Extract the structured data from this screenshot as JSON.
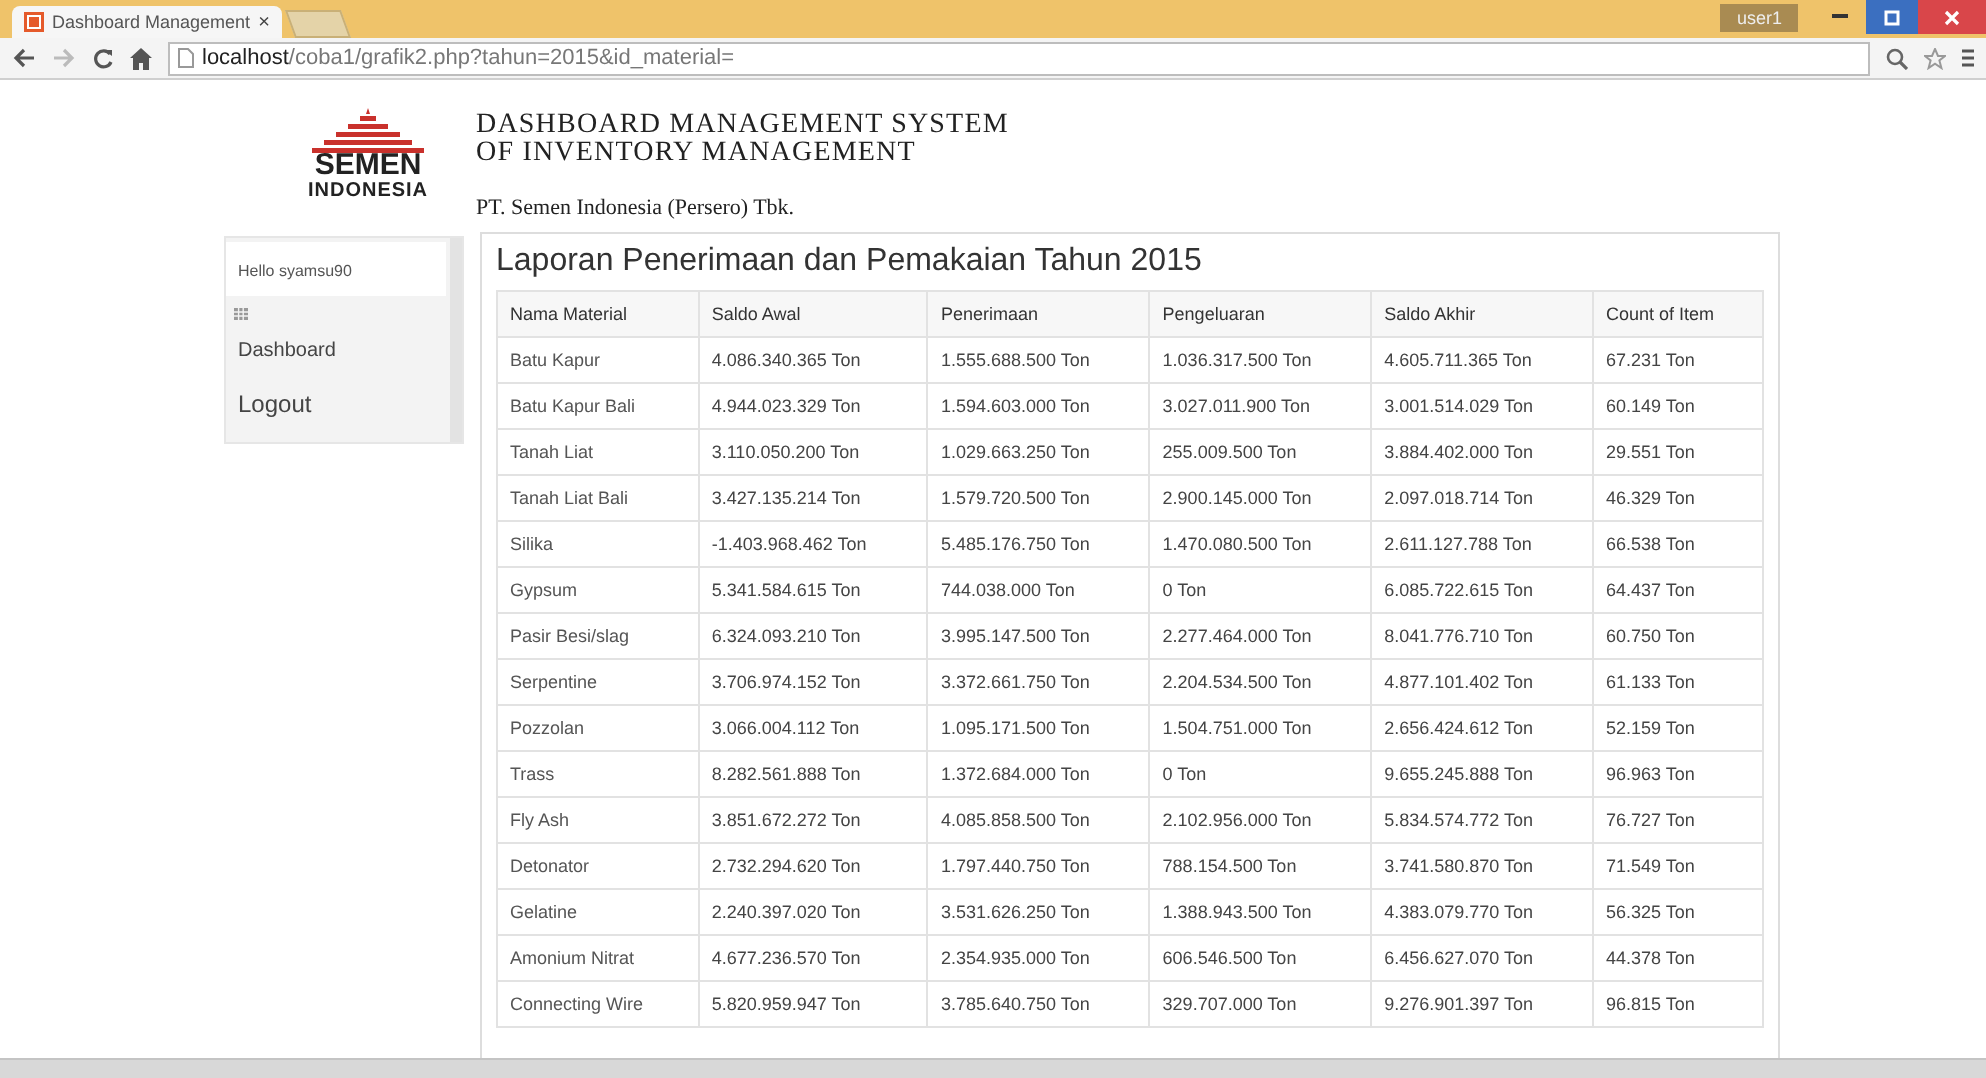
{
  "browser": {
    "tab_title": "Dashboard Management",
    "tab_close": "×",
    "address": "localhost/coba1/grafik2.php?tahun=2015&id_material=",
    "user_badge": "user1"
  },
  "header": {
    "logo_word": "SEMEN",
    "logo_subword": "INDONESIA",
    "title_line_1": "DASHBOARD MANAGEMENT SYSTEM",
    "title_line_2": "OF INVENTORY MANAGEMENT",
    "company": "PT. Semen Indonesia (Persero) Tbk."
  },
  "sidebar": {
    "greeting": "Hello syamsu90",
    "items": [
      {
        "label": "Dashboard"
      },
      {
        "label": "Logout"
      }
    ]
  },
  "report": {
    "title": "Laporan Penerimaan dan Pemakaian Tahun 2015",
    "columns": [
      "Nama Material",
      "Saldo Awal",
      "Penerimaan",
      "Pengeluaran",
      "Saldo Akhir",
      "Count of Item"
    ],
    "rows": [
      [
        "Batu Kapur",
        "4.086.340.365 Ton",
        "1.555.688.500 Ton",
        "1.036.317.500 Ton",
        "4.605.711.365 Ton",
        "67.231 Ton"
      ],
      [
        "Batu Kapur Bali",
        "4.944.023.329 Ton",
        "1.594.603.000 Ton",
        "3.027.011.900 Ton",
        "3.001.514.029 Ton",
        "60.149 Ton"
      ],
      [
        "Tanah Liat",
        "3.110.050.200 Ton",
        "1.029.663.250 Ton",
        "255.009.500 Ton",
        "3.884.402.000 Ton",
        "29.551 Ton"
      ],
      [
        "Tanah Liat Bali",
        "3.427.135.214 Ton",
        "1.579.720.500 Ton",
        "2.900.145.000 Ton",
        "2.097.018.714 Ton",
        "46.329 Ton"
      ],
      [
        "Silika",
        "-1.403.968.462 Ton",
        "5.485.176.750 Ton",
        "1.470.080.500 Ton",
        "2.611.127.788 Ton",
        "66.538 Ton"
      ],
      [
        "Gypsum",
        "5.341.584.615 Ton",
        "744.038.000 Ton",
        "0 Ton",
        "6.085.722.615 Ton",
        "64.437 Ton"
      ],
      [
        "Pasir Besi/slag",
        "6.324.093.210 Ton",
        "3.995.147.500 Ton",
        "2.277.464.000 Ton",
        "8.041.776.710 Ton",
        "60.750 Ton"
      ],
      [
        "Serpentine",
        "3.706.974.152 Ton",
        "3.372.661.750 Ton",
        "2.204.534.500 Ton",
        "4.877.101.402 Ton",
        "61.133 Ton"
      ],
      [
        "Pozzolan",
        "3.066.004.112 Ton",
        "1.095.171.500 Ton",
        "1.504.751.000 Ton",
        "2.656.424.612 Ton",
        "52.159 Ton"
      ],
      [
        "Trass",
        "8.282.561.888 Ton",
        "1.372.684.000 Ton",
        "0 Ton",
        "9.655.245.888 Ton",
        "96.963 Ton"
      ],
      [
        "Fly Ash",
        "3.851.672.272 Ton",
        "4.085.858.500 Ton",
        "2.102.956.000 Ton",
        "5.834.574.772 Ton",
        "76.727 Ton"
      ],
      [
        "Detonator",
        "2.732.294.620 Ton",
        "1.797.440.750 Ton",
        "788.154.500 Ton",
        "3.741.580.870 Ton",
        "71.549 Ton"
      ],
      [
        "Gelatine",
        "2.240.397.020 Ton",
        "3.531.626.250 Ton",
        "1.388.943.500 Ton",
        "4.383.079.770 Ton",
        "56.325 Ton"
      ],
      [
        "Amonium Nitrat",
        "4.677.236.570 Ton",
        "2.354.935.000 Ton",
        "606.546.500 Ton",
        "6.456.627.070 Ton",
        "44.378 Ton"
      ],
      [
        "Connecting Wire",
        "5.820.959.947 Ton",
        "3.785.640.750 Ton",
        "329.707.000 Ton",
        "9.276.901.397 Ton",
        "96.815 Ton"
      ]
    ]
  }
}
